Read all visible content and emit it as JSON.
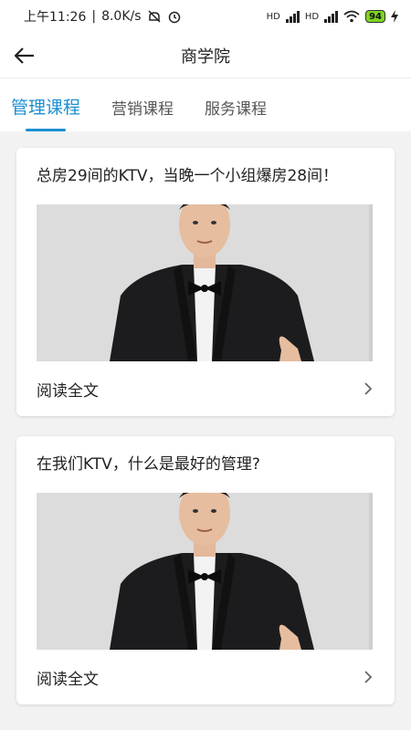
{
  "status": {
    "time": "上午11:26",
    "speed": "8.0K/s",
    "battery": "94",
    "hd1": "HD",
    "hd2": "HD"
  },
  "header": {
    "title": "商学院"
  },
  "tabs": [
    {
      "label": "管理课程",
      "active": true
    },
    {
      "label": "营销课程",
      "active": false
    },
    {
      "label": "服务课程",
      "active": false
    }
  ],
  "cards": [
    {
      "title": "总房29间的KTV，当晚一个小组爆房28间！",
      "read_label": "阅读全文"
    },
    {
      "title": "在我们KTV，什么是最好的管理?",
      "read_label": "阅读全文"
    }
  ],
  "colors": {
    "accent": "#1b8fd1",
    "background": "#f2f2f2"
  },
  "icons": {
    "back": "arrow-left-icon",
    "chevron": "chevron-right-icon"
  }
}
